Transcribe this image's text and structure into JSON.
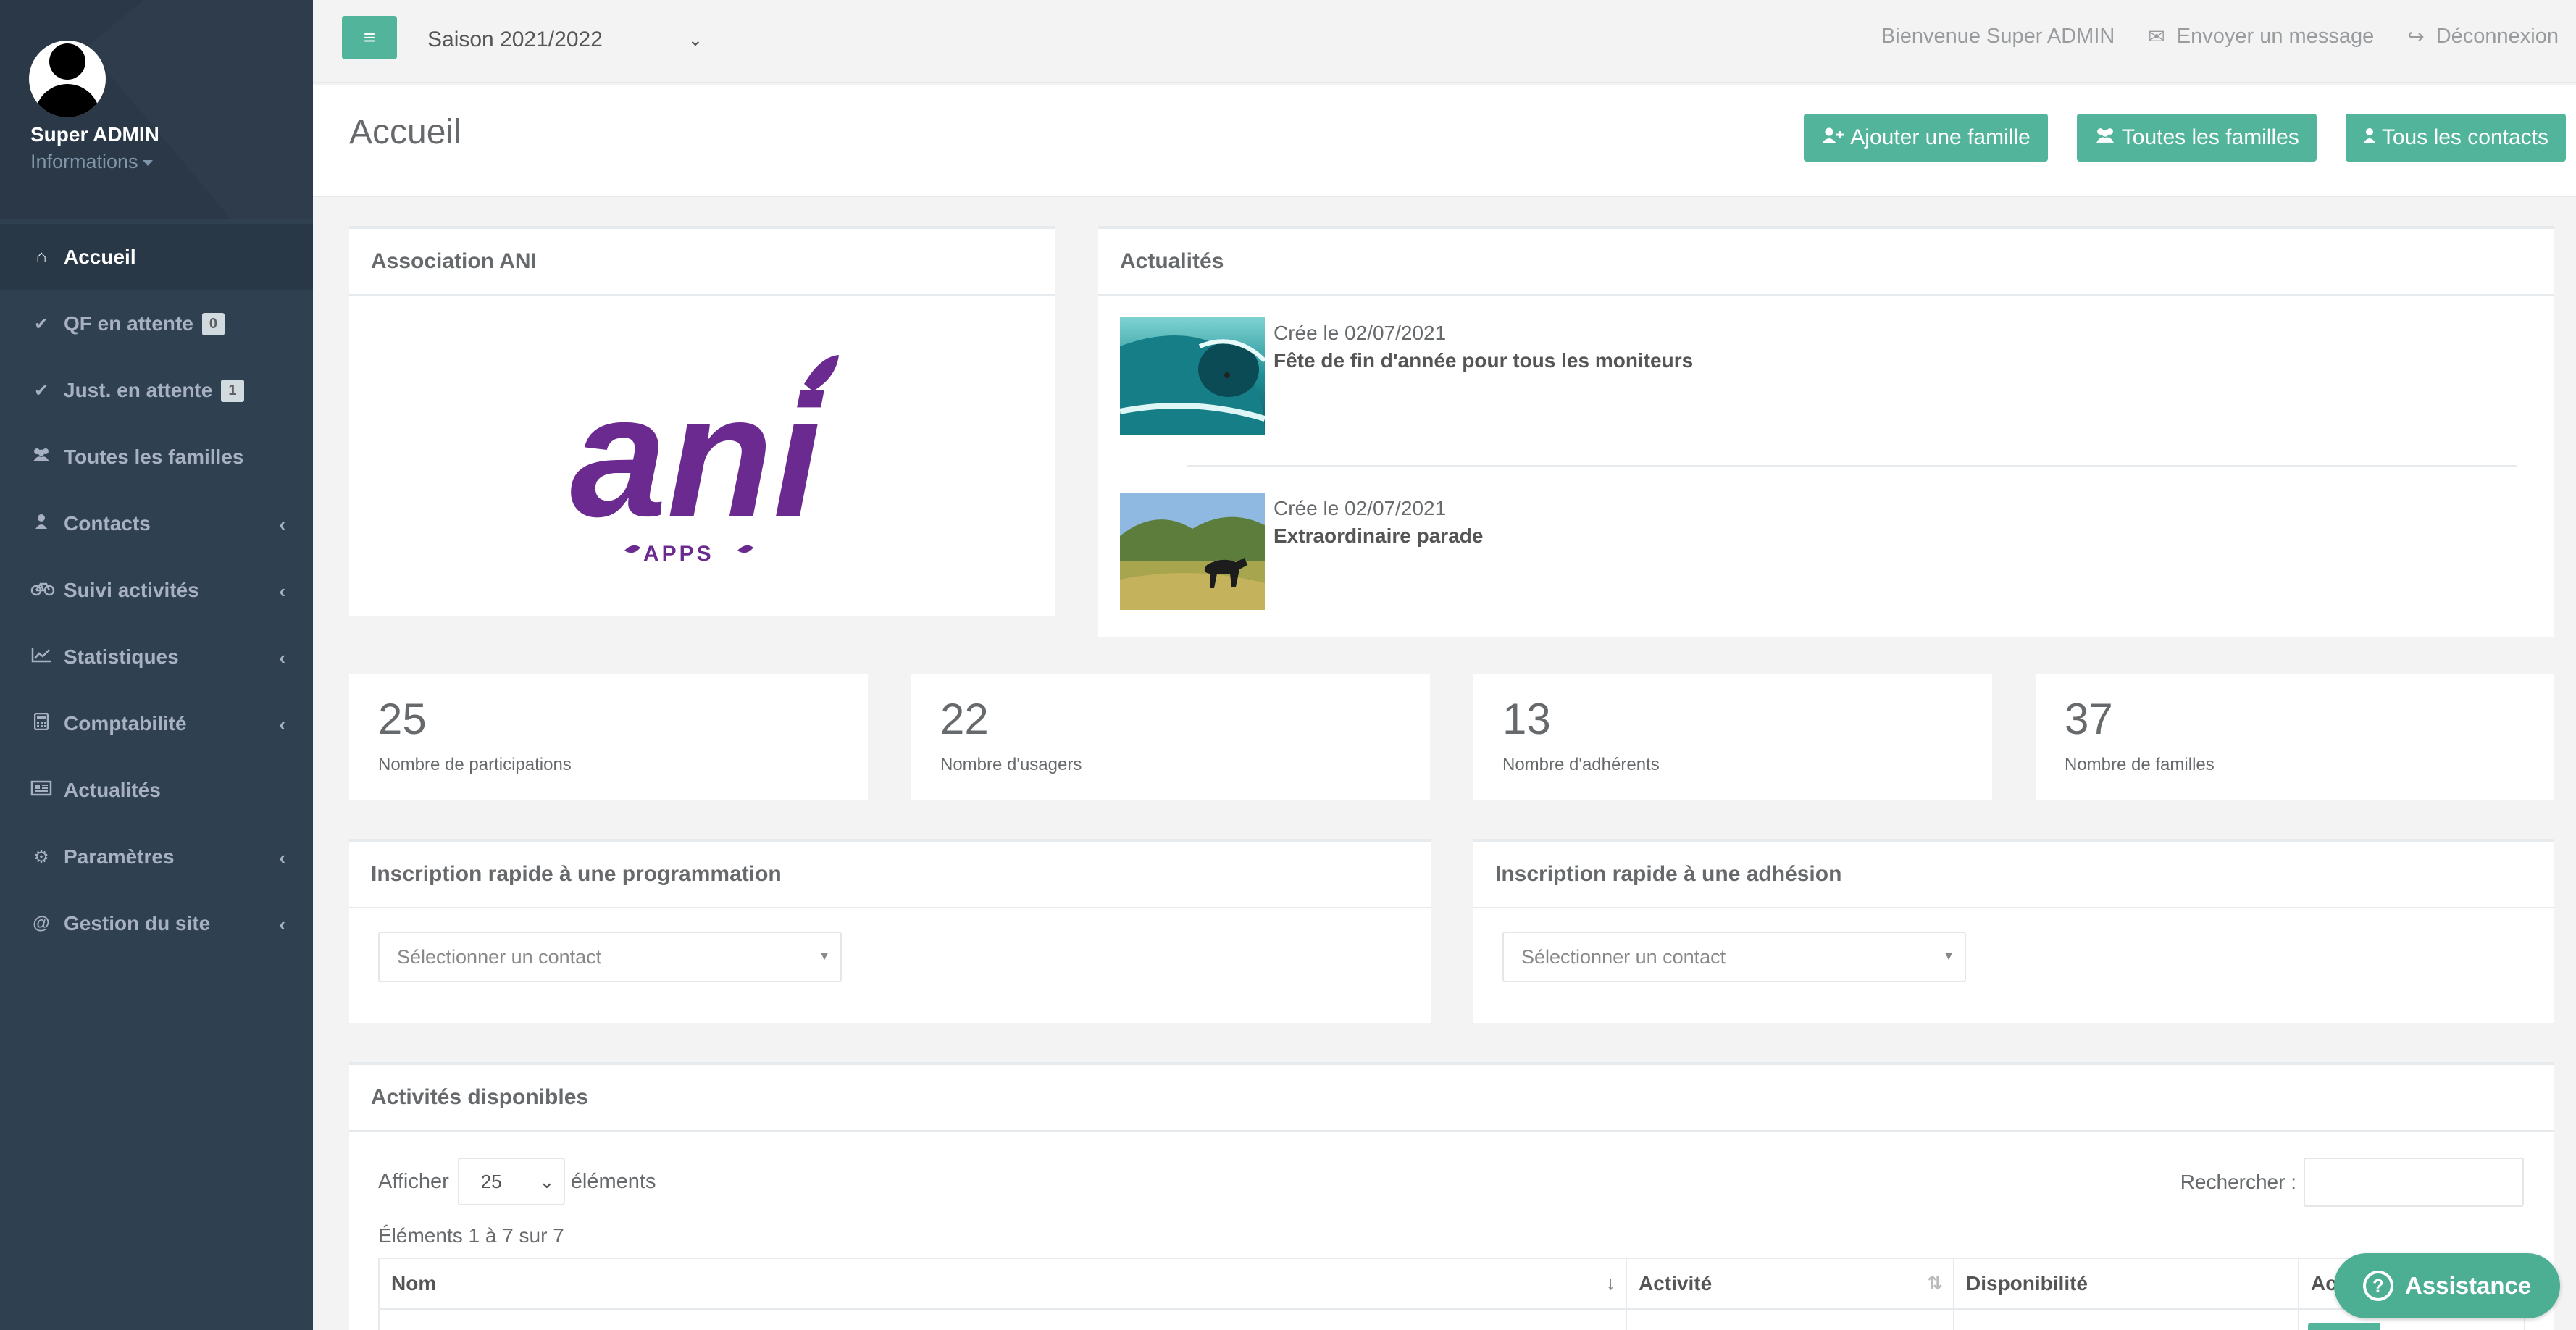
{
  "colors": {
    "sidebar": "#2f4050",
    "accent": "#52b49a",
    "logo_purple": "#6b2a8f"
  },
  "profile": {
    "name": "Super ADMIN",
    "info": "Informations"
  },
  "nav": [
    {
      "label": "Accueil",
      "icon": "home-icon",
      "active": true
    },
    {
      "label": "QF en attente",
      "icon": "check-icon",
      "badge": "0"
    },
    {
      "label": "Just. en attente",
      "icon": "check-icon",
      "badge": "1"
    },
    {
      "label": "Toutes les familles",
      "icon": "users-icon"
    },
    {
      "label": "Contacts",
      "icon": "user-icon",
      "submenu": true
    },
    {
      "label": "Suivi activités",
      "icon": "bicycle-icon",
      "submenu": true
    },
    {
      "label": "Statistiques",
      "icon": "line-chart-icon",
      "submenu": true
    },
    {
      "label": "Comptabilité",
      "icon": "calculator-icon",
      "submenu": true
    },
    {
      "label": "Actualités",
      "icon": "newspaper-icon"
    },
    {
      "label": "Paramètres",
      "icon": "cogs-icon",
      "submenu": true
    },
    {
      "label": "Gestion du site",
      "icon": "at-icon",
      "submenu": true
    }
  ],
  "topbar": {
    "season": "Saison 2021/2022",
    "welcome": "Bienvenue Super ADMIN",
    "message": "Envoyer un message",
    "logout": "Déconnexion"
  },
  "heading": {
    "title": "Accueil",
    "btn_add_family": "Ajouter une famille",
    "btn_all_families": "Toutes les familles",
    "btn_all_contacts": "Tous les contacts"
  },
  "association": {
    "title": "Association ANI",
    "logo_text": "ani",
    "logo_sub": "APPS"
  },
  "news": {
    "title": "Actualités",
    "items": [
      {
        "date": "Crée le 02/07/2021",
        "title": "Fête de fin d'année pour tous les moniteurs",
        "thumb": "wave-surf-image"
      },
      {
        "date": "Crée le 02/07/2021",
        "title": "Extraordinaire parade",
        "thumb": "horse-field-image"
      }
    ]
  },
  "stats": [
    {
      "value": "25",
      "label": "Nombre de participations"
    },
    {
      "value": "22",
      "label": "Nombre d'usagers"
    },
    {
      "value": "13",
      "label": "Nombre d'adhérents"
    },
    {
      "value": "37",
      "label": "Nombre de familles"
    }
  ],
  "quick_prog": {
    "title": "Inscription rapide à une programmation",
    "placeholder": "Sélectionner un contact"
  },
  "quick_adh": {
    "title": "Inscription rapide à une adhésion",
    "placeholder": "Sélectionner un contact"
  },
  "activities": {
    "title": "Activités disponibles",
    "show_label": "Afficher",
    "page_size": "25",
    "elements_label": "éléments",
    "search_label": "Rechercher :",
    "info": "Éléments 1 à 7 sur 7",
    "columns": [
      "Nom",
      "Activité",
      "Disponibilité",
      "Ac"
    ]
  },
  "assistance": {
    "label": "Assistance"
  }
}
